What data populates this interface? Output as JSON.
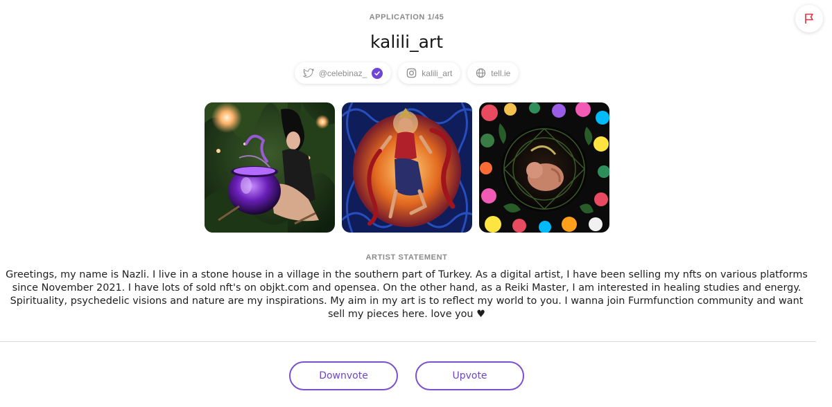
{
  "header": {
    "kicker": "APPLICATION 1/45",
    "title": "kalili_art"
  },
  "socials": {
    "twitter": {
      "handle": "@celebinaz_",
      "icon": "twitter-icon",
      "verified": true
    },
    "instagram": {
      "handle": "kalili_art",
      "icon": "instagram-icon"
    },
    "website": {
      "label": "tell.ie",
      "icon": "globe-icon"
    }
  },
  "gallery": [
    {
      "name": "artwork-witch-cauldron"
    },
    {
      "name": "artwork-dancing-deity"
    },
    {
      "name": "artwork-floral-embryo"
    }
  ],
  "statement": {
    "label": "ARTIST STATEMENT",
    "text": "Greetings, my name is Nazli. I live in a stone house in a village in the southern part of Turkey. As a digital artist, I have been selling my nfts on various platforms since November 2021. I have lots of sold nft's on objkt.com and opensea. On the other hand, as a Reiki Master, I am interested in healing studies and energy. Spirituality, psychedelic visions and nature are my inspirations. My aim in my art is to reflect my world to you. I wanna join Furmfunction community and want sell my pieces here. love you ♥"
  },
  "actions": {
    "downvote": "Downvote",
    "upvote": "Upvote"
  },
  "colors": {
    "accent": "#7b4fd0",
    "flag": "#e0303a",
    "verified": "#6e45d6"
  }
}
